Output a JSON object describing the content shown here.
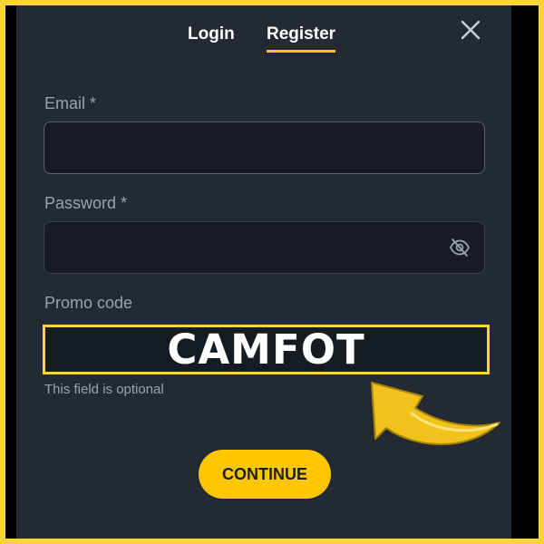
{
  "tabs": {
    "login": "Login",
    "register": "Register",
    "active": "register"
  },
  "form": {
    "email_label": "Email *",
    "email_value": "",
    "password_label": "Password *",
    "password_value": "",
    "promo_label": "Promo code",
    "promo_value": "CAMFOT",
    "promo_hint": "This field is optional"
  },
  "actions": {
    "continue_label": "CONTINUE",
    "close_icon": "close-icon",
    "password_toggle_icon": "eye-off-icon"
  },
  "colors": {
    "accent": "#ffc700",
    "highlight_border": "#ffd43b",
    "modal_bg": "#242a31",
    "field_bg": "#161c22",
    "label_text": "#9aa3ad"
  }
}
